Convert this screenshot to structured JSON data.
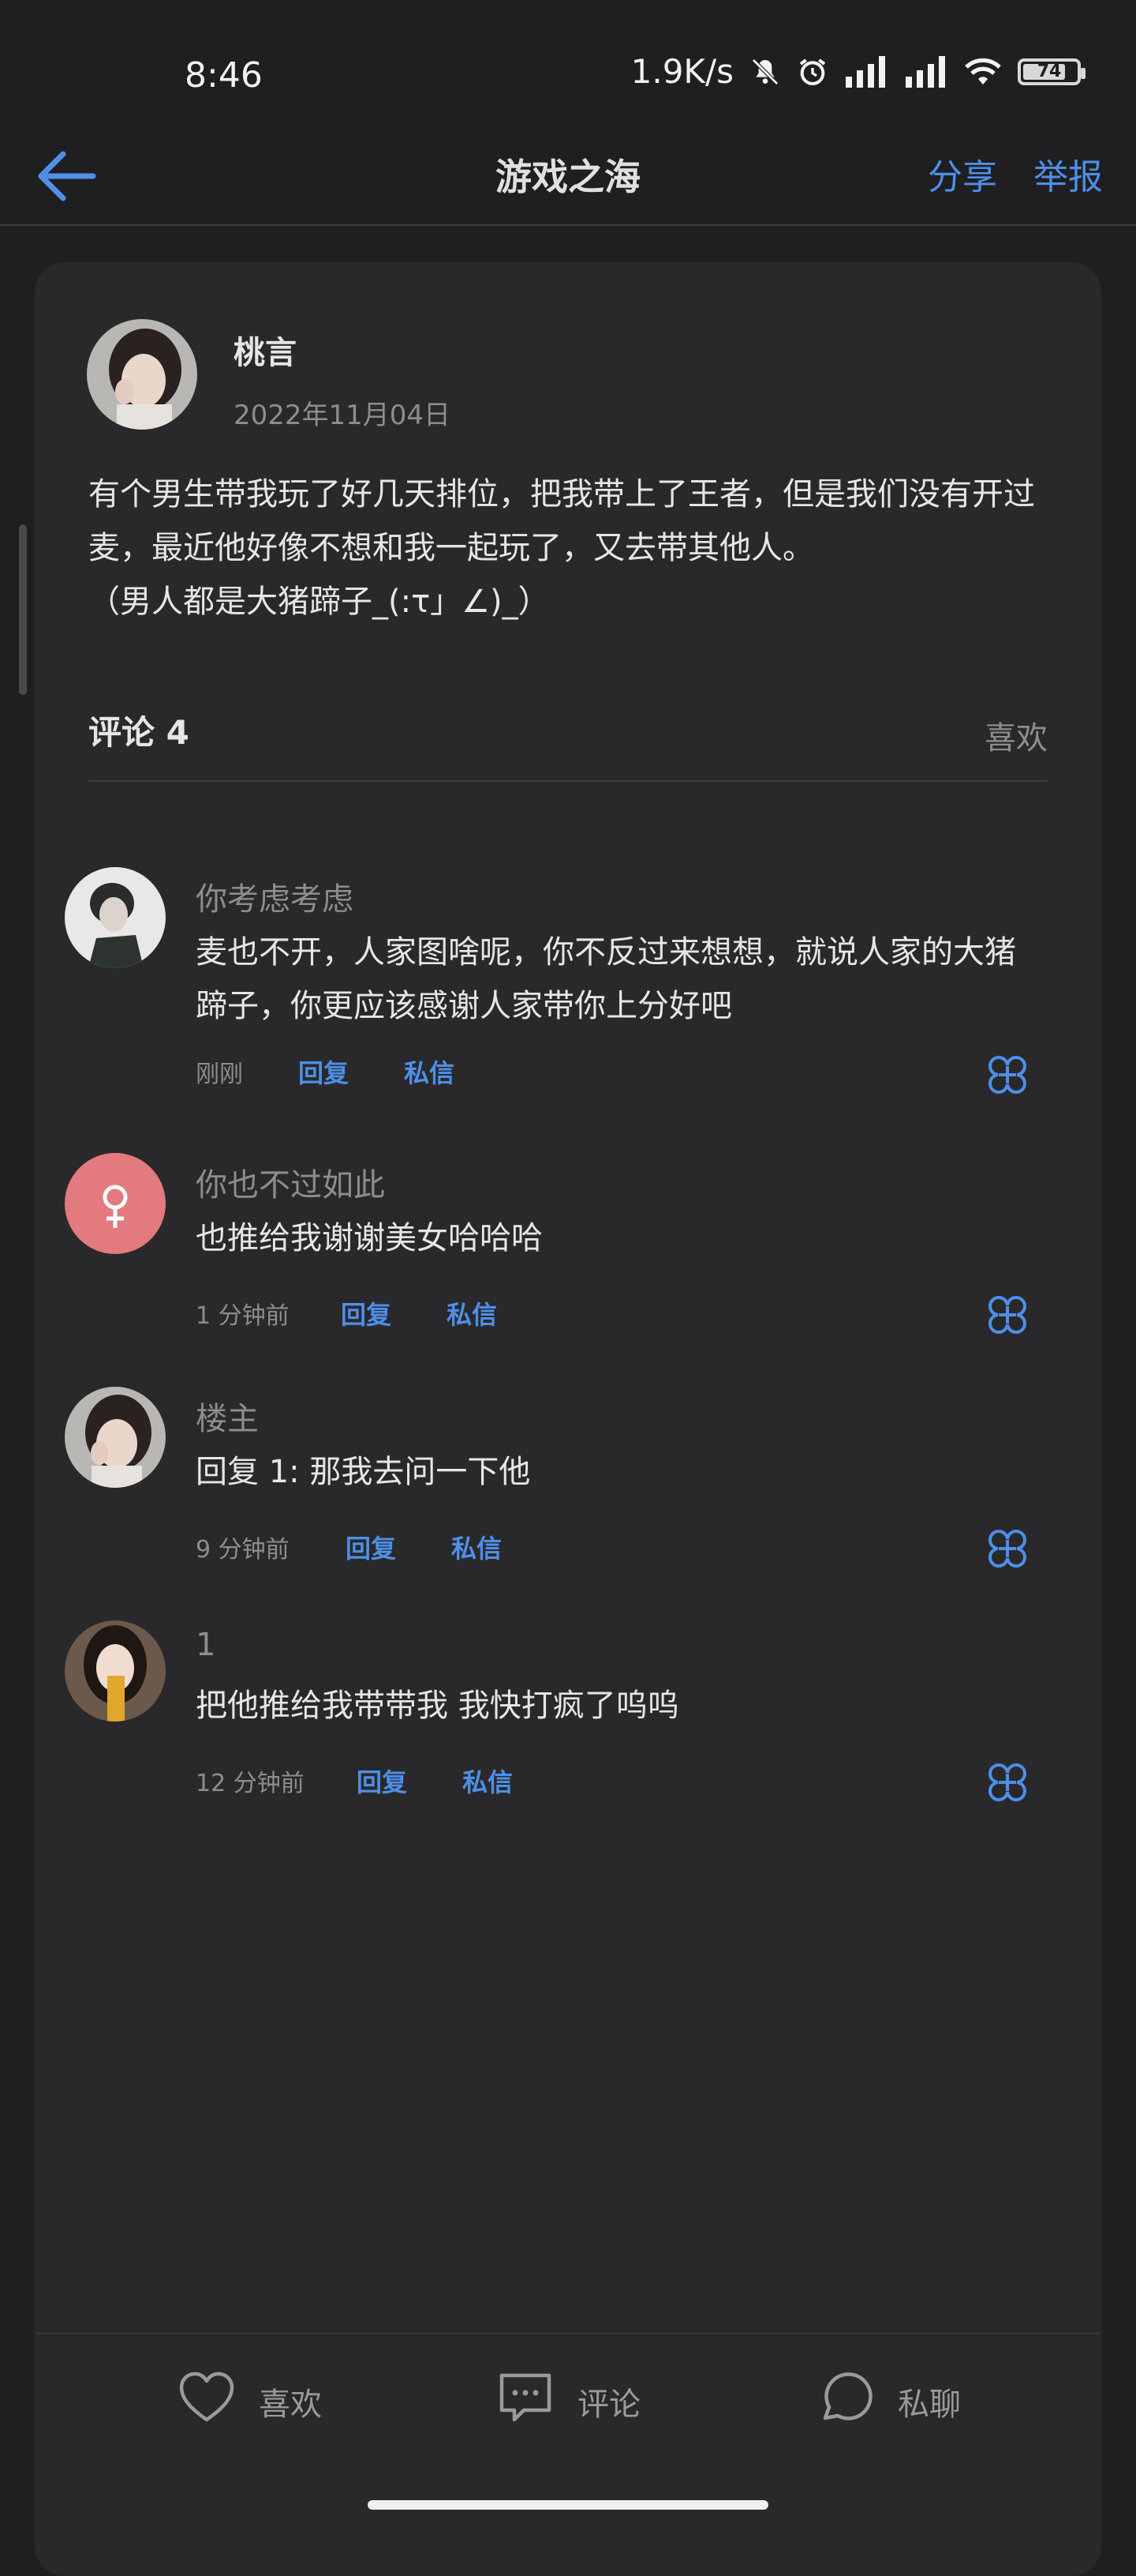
{
  "status_bar": {
    "time": "8:46",
    "net_speed": "1.9K/s",
    "battery": "74"
  },
  "header": {
    "title": "游戏之海",
    "share": "分享",
    "report": "举报"
  },
  "post": {
    "author": "桃言",
    "date": "2022年11月04日",
    "text": "有个男生带我玩了好几天排位，把我带上了王者，但是我们没有开过麦，最近他好像不想和我一起玩了，又去带其他人。\n（男人都是大猪蹄子_(:τ」∠)_）"
  },
  "comments_section": {
    "title": "评论 4",
    "likes_label": "喜欢"
  },
  "comments": [
    {
      "name": "你考虑考虑",
      "text": "麦也不开，人家图啥呢，你不反过来想想，就说人家的大猪蹄子，你更应该感谢人家带你上分好吧",
      "time": "刚刚",
      "reply": "回复",
      "dm": "私信"
    },
    {
      "name": "你也不过如此",
      "text": "也推给我谢谢美女哈哈哈",
      "time": "1 分钟前",
      "reply": "回复",
      "dm": "私信"
    },
    {
      "name": "楼主",
      "text": "回复 1: 那我去问一下他",
      "time": "9 分钟前",
      "reply": "回复",
      "dm": "私信"
    },
    {
      "name": "1",
      "text": "把他推给我带带我 我快打疯了呜呜",
      "time": "12 分钟前",
      "reply": "回复",
      "dm": "私信"
    }
  ],
  "bottom_bar": {
    "like": "喜欢",
    "comment": "评论",
    "chat": "私聊"
  },
  "colors": {
    "accent": "#4e8fe8",
    "background": "#1f1f21",
    "card": "#29292b",
    "female_avatar": "#e27a7e"
  }
}
